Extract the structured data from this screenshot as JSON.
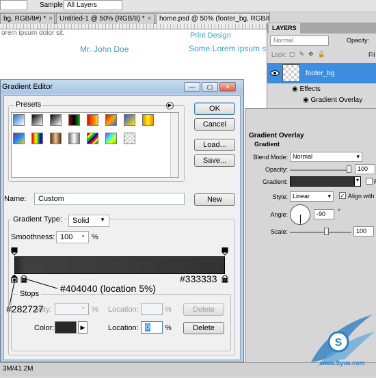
{
  "options_bar": {
    "sample_label": "Sample:",
    "sample_value": "All Layers"
  },
  "doc_tabs": [
    {
      "label": "bg, RGB/8#) *"
    },
    {
      "label": "Untitled-1 @ 50% (RGB/8) *"
    },
    {
      "label": "home.psd @ 50% (footer_bg, RGB/8#) *"
    }
  ],
  "canvas": {
    "lorem_top": "orem ipsum dolor sit.",
    "name": "Mr. John Doe",
    "print_design": "Print Design",
    "some_lorem": "Some Lorem ipsum s"
  },
  "status": {
    "doc_size": "3M/41.2M"
  },
  "layers_panel": {
    "tab": "LAYERS",
    "blend_mode": "Normal",
    "opacity_label": "Opacity:",
    "lock_label": "Lock:",
    "fill_label": "Fil",
    "layer_name": "footer_bg",
    "effects_label": "Effects",
    "effect_item": "Gradient Overlay"
  },
  "layer_style": {
    "section": "Gradient Overlay",
    "subsection": "Gradient",
    "blend_mode_label": "Blend Mode:",
    "blend_mode": "Normal",
    "opacity_label": "Opacity:",
    "opacity": "100",
    "gradient_label": "Gradient:",
    "reverse_label": "R",
    "style_label": "Style:",
    "style": "Linear",
    "align_label": "Align with",
    "angle_label": "Angle:",
    "angle": "-90",
    "degree": "°",
    "scale_label": "Scale:",
    "scale": "100"
  },
  "gradient_editor": {
    "title": "Gradient Editor",
    "presets_label": "Presets",
    "buttons": {
      "ok": "OK",
      "cancel": "Cancel",
      "load": "Load...",
      "save": "Save...",
      "new": "New"
    },
    "name_label": "Name:",
    "name_value": "Custom",
    "gradient_type_label": "Gradient Type:",
    "gradient_type": "Solid",
    "smoothness_label": "Smoothness:",
    "smoothness": "100",
    "percent": "%",
    "stops_label": "Stops",
    "opacity_label": "acity:",
    "location_label": "Location:",
    "delete_label": "Delete",
    "color_label": "Color:",
    "color_location": "0"
  },
  "annotations": {
    "left_color": "#282727",
    "mid_color": "#404040 (location 5%)",
    "right_color": "#333333"
  },
  "colors": {
    "accent": "#3aa0c8",
    "layer_selected": "#3d8ee0",
    "gradient_start": "#282727",
    "gradient_mid": "#404040",
    "gradient_end": "#333333"
  },
  "watermark": {
    "text": "www.Syue.com"
  }
}
